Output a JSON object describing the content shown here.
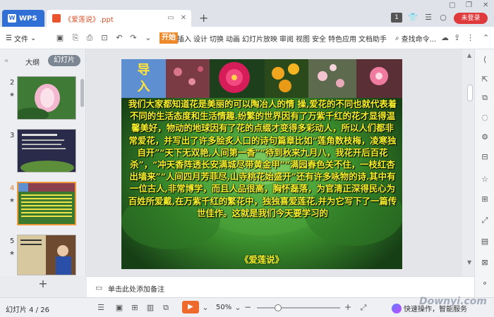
{
  "titlebar": {
    "app_name": "WPS",
    "doc_tab": "《爱莲说》.ppt",
    "slide_badge": "1",
    "login": "未登录"
  },
  "toolbar": {
    "file_menu": "文件",
    "start_tab": "开始",
    "tabs": [
      "插入",
      "设计",
      "切换",
      "动画",
      "幻灯片放映",
      "审阅",
      "视图",
      "安全",
      "特色应用",
      "文档助手"
    ],
    "search": "查找命令..."
  },
  "left_panel": {
    "outline_tab": "大纲",
    "slides_tab": "幻灯片",
    "thumbnails": [
      {
        "num": "2"
      },
      {
        "num": "3"
      },
      {
        "num": "4"
      },
      {
        "num": "5"
      }
    ]
  },
  "slide": {
    "title_line1": "导",
    "title_line2": "入",
    "body": "我们大家都知道花是美丽的可以陶冶人的情 操,爱花的不同也就代表着不同的生活态度和生活情趣.纷繁的世界因有了万紫千红的花才显得温馨美好，物动的地球因有了花的点缀才变得多彩动人，所以人们都非常爱花，并写出了许多脍炙人口的诗句篇章比如“莲角数枝梅，凌寒独自开”“天下无双艳,人间第一香”“待到秋来九月八，我花开后百花杀”，“冲天香阵透长安满城尽带黄金甲”“满园春色关不住，一枝红杏出墙来”“人间四月芳菲尽,山寺桃花始盛开”还有许多咏物的诗.其中有一位古人,非常博学，而且人品很高，胸怀磊落，为官清正深得民心为百姓所爱戴,在万紫千红的繁花中，独独喜爱莲花,并为它写下了一篇传世佳作。这就是我们今天要学习的",
    "ending": "《爱莲说》"
  },
  "notes": {
    "placeholder": "单击此处添加备注"
  },
  "status": {
    "slide_indicator": "幻灯片 4 / 26",
    "zoom": "50%",
    "zoom_fraction": 0.25,
    "ai_label": "快速操作，智能服务",
    "watermark": "Downyi.com"
  }
}
